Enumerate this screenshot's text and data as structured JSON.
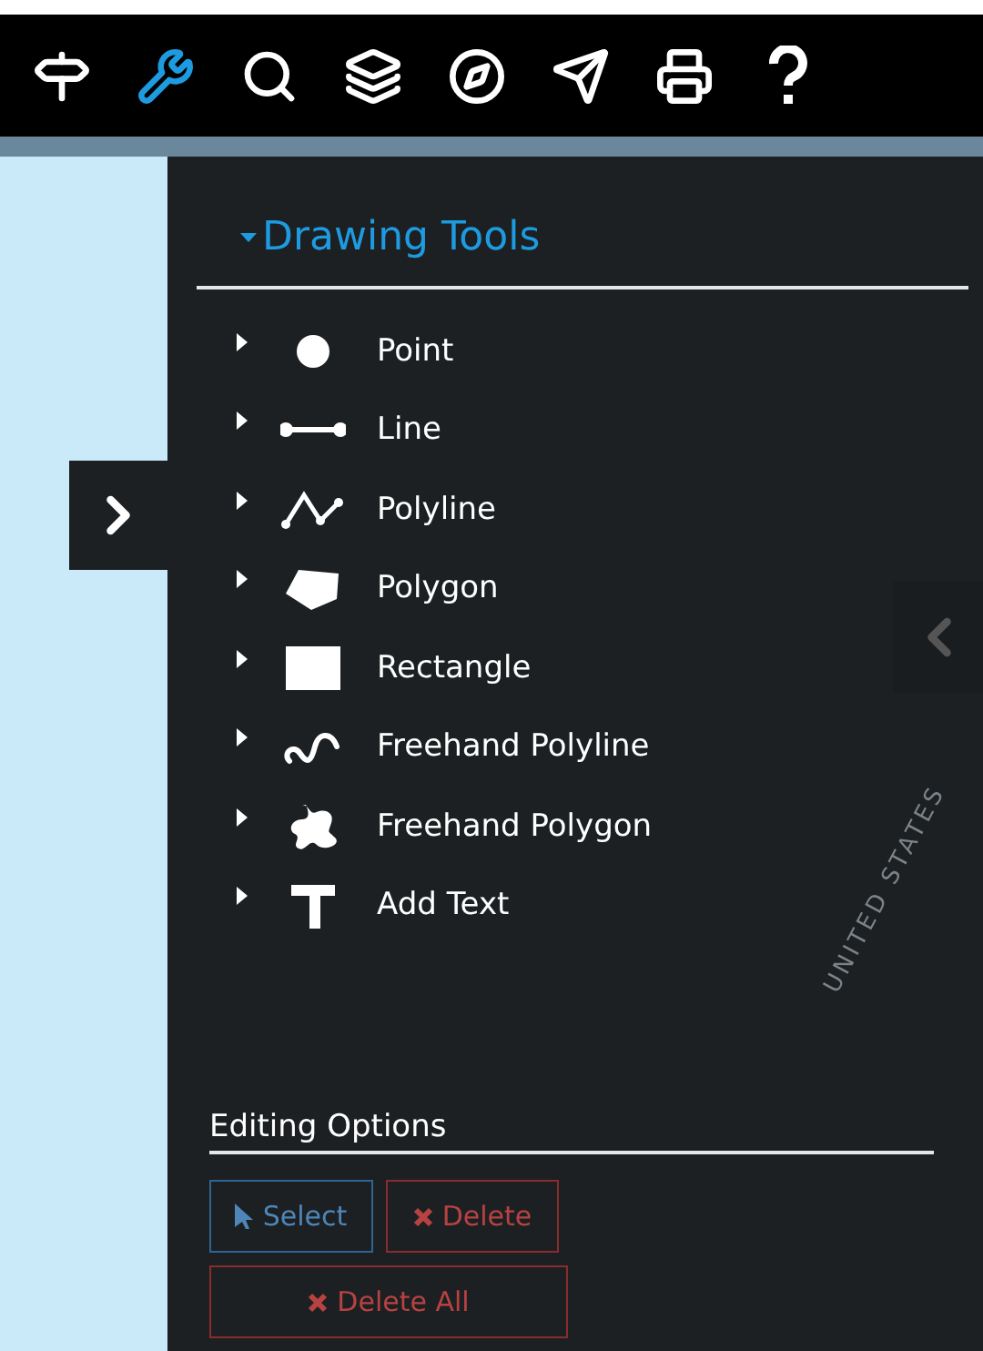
{
  "toolbar": [
    {
      "kind": "signpost",
      "selected": false
    },
    {
      "kind": "wrench",
      "selected": true
    },
    {
      "kind": "search",
      "selected": false
    },
    {
      "kind": "layers",
      "selected": false
    },
    {
      "kind": "compass",
      "selected": false
    },
    {
      "kind": "send",
      "selected": false
    },
    {
      "kind": "printer",
      "selected": false
    },
    {
      "kind": "help",
      "selected": false
    }
  ],
  "panel": {
    "title": "Drawing Tools",
    "expanded": true,
    "tools": [
      {
        "kind": "point",
        "label": "Point"
      },
      {
        "kind": "line",
        "label": "Line"
      },
      {
        "kind": "polyline",
        "label": "Polyline"
      },
      {
        "kind": "polygon",
        "label": "Polygon"
      },
      {
        "kind": "rectangle",
        "label": "Rectangle"
      },
      {
        "kind": "freehand_polyline",
        "label": "Freehand Polyline"
      },
      {
        "kind": "freehand_polygon",
        "label": "Freehand Polygon"
      },
      {
        "kind": "text",
        "label": "Add Text"
      }
    ],
    "editing": {
      "title": "Editing Options",
      "buttons": [
        {
          "kind": "select",
          "label": "Select",
          "disabled": true
        },
        {
          "kind": "delete",
          "label": "Delete",
          "disabled": true
        },
        {
          "kind": "delete_all",
          "label": "Delete All",
          "disabled": true
        }
      ]
    }
  },
  "map_label": "UNITED STATES"
}
